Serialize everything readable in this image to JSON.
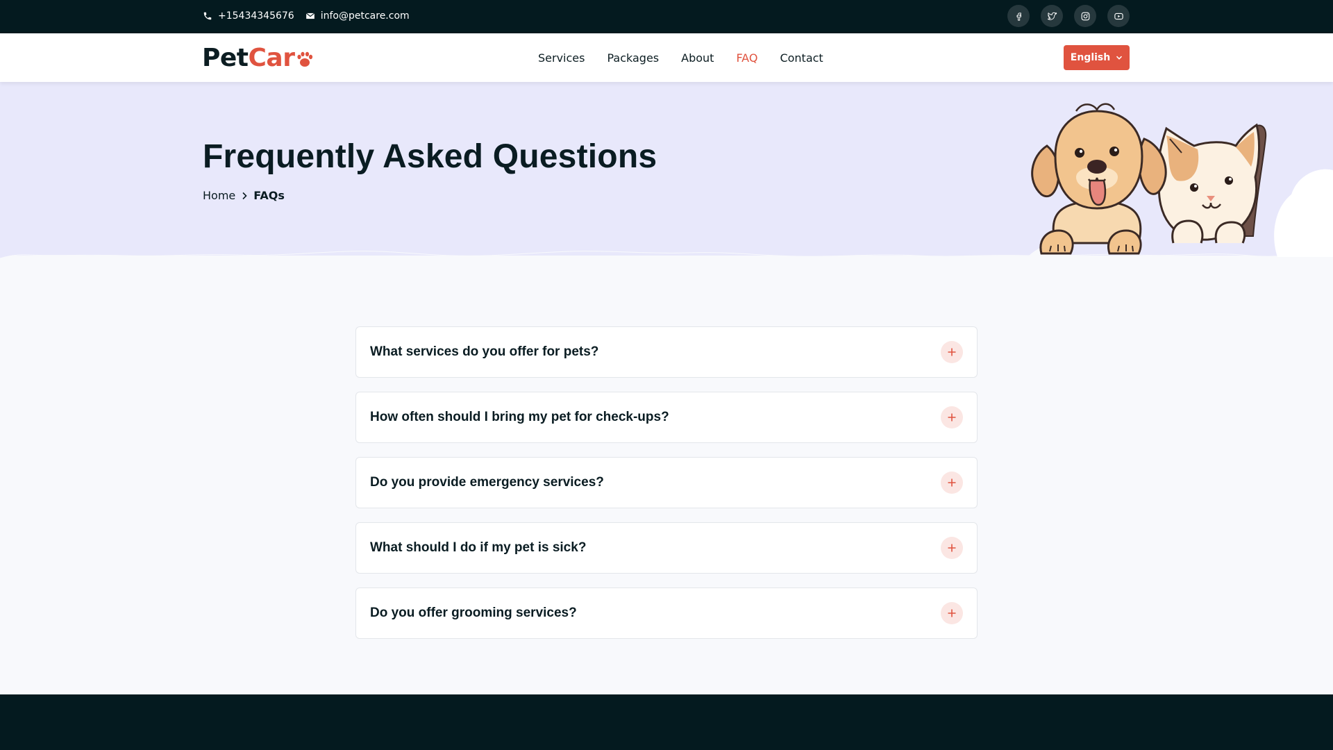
{
  "topbar": {
    "phone": "+15434345676",
    "email": "info@petcare.com",
    "social": [
      {
        "icon": "facebook-icon"
      },
      {
        "icon": "twitter-icon"
      },
      {
        "icon": "instagram-icon"
      },
      {
        "icon": "youtube-icon"
      }
    ]
  },
  "nav": {
    "logo_part1": "Pet",
    "logo_part2": "Car",
    "links": [
      {
        "label": "Services"
      },
      {
        "label": "Packages"
      },
      {
        "label": "About"
      },
      {
        "label": "FAQ",
        "active": true
      },
      {
        "label": "Contact"
      }
    ],
    "language": "English"
  },
  "hero": {
    "title": "Frequently Asked Questions",
    "breadcrumb_home": "Home",
    "breadcrumb_current": "FAQs"
  },
  "faq": [
    {
      "question": "What services do you offer for pets?"
    },
    {
      "question": "How often should I bring my pet for check-ups?"
    },
    {
      "question": "Do you provide emergency services?"
    },
    {
      "question": "What should I do if my pet is sick?"
    },
    {
      "question": "Do you offer grooming services?"
    }
  ],
  "colors": {
    "accent": "#e0533f",
    "dark": "#041a1f",
    "hero_bg": "#e8e8fb"
  }
}
